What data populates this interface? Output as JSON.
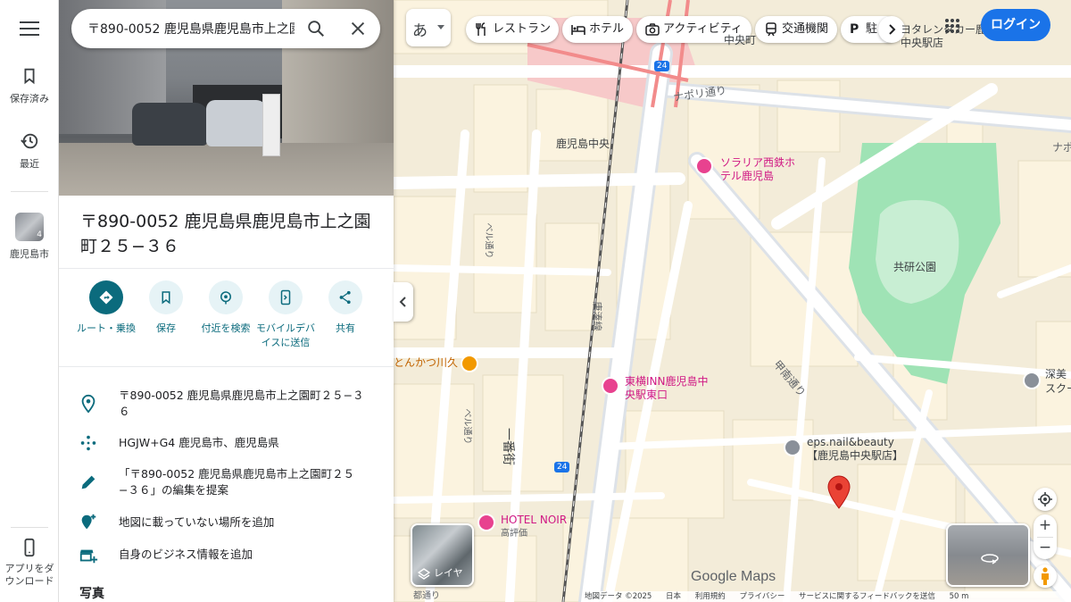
{
  "rail": {
    "saved": "保存済み",
    "recent": "最近",
    "city": "鹿児島市",
    "city_badge": "4",
    "app": "アプリをダウンロード"
  },
  "search": {
    "value": "〒890-0052 鹿児島県鹿児島市上之園"
  },
  "place": {
    "title": "〒890-0052 鹿児島県鹿児島市上之園町２５−３６"
  },
  "actions": [
    {
      "label": "ルート・乗換"
    },
    {
      "label": "保存"
    },
    {
      "label": "付近を検索"
    },
    {
      "label": "モバイルデバイスに送信"
    },
    {
      "label": "共有"
    }
  ],
  "info": [
    {
      "icon": "location-pin-icon",
      "text": "〒890-0052 鹿児島県鹿児島市上之園町２５−３６"
    },
    {
      "icon": "plus-code-icon",
      "text": "HGJW+G4 鹿児島市、鹿児島県"
    },
    {
      "icon": "pencil-icon",
      "text": "「〒890-0052 鹿児島県鹿児島市上之園町２５−３６」の編集を提案"
    },
    {
      "icon": "add-place-icon",
      "text": "地図に載っていない場所を追加"
    },
    {
      "icon": "add-business-icon",
      "text": "自身のビジネス情報を追加"
    }
  ],
  "photos_heading": "写真",
  "map": {
    "lang_button": "あ",
    "chips": [
      "レストラン",
      "ホテル",
      "アクティビティ",
      "交通機関",
      "駐"
    ],
    "login": "ログイン",
    "layer_label": "レイヤ",
    "brand": "Google Maps",
    "labels": {
      "station": "鹿児島中央",
      "napoli": "ナポリ通り",
      "napoli2": "ナポリ",
      "kyoken": "共研公園",
      "konan": "甲南通り",
      "ichiban": "一番街",
      "belu1": "べル通り",
      "belu2": "べル通り",
      "tosaki": "唐湊線",
      "route1": "24",
      "route2": "24",
      "tonkatsu": "とんかつ川久",
      "solaria": "ソラリア西鉄ホテル鹿児島",
      "toyoko": "東横INN鹿児島中央駅東口",
      "noir": "HOTEL NOIR",
      "noir_sub": "高評価",
      "eps": "eps.nail&beauty【鹿児島中央駅店】",
      "toyota": "ヨタレンタカー鹿児島中央駅店",
      "fukami": "深美",
      "sukul": "スクー",
      "chuo_top": "中央町",
      "miyako": "都通り"
    },
    "footer": [
      "地図データ ©2025",
      "日本",
      "利用規約",
      "プライバシー",
      "サービスに関するフィードバックを送信",
      "50 m"
    ]
  },
  "colors": {
    "accent": "#0b6b7d",
    "login_blue": "#1a73e8",
    "hotel_pink": "#e8428f",
    "food_orange": "#f29900",
    "marker_red": "#ea4335",
    "park_green": "#9fe3b5"
  }
}
